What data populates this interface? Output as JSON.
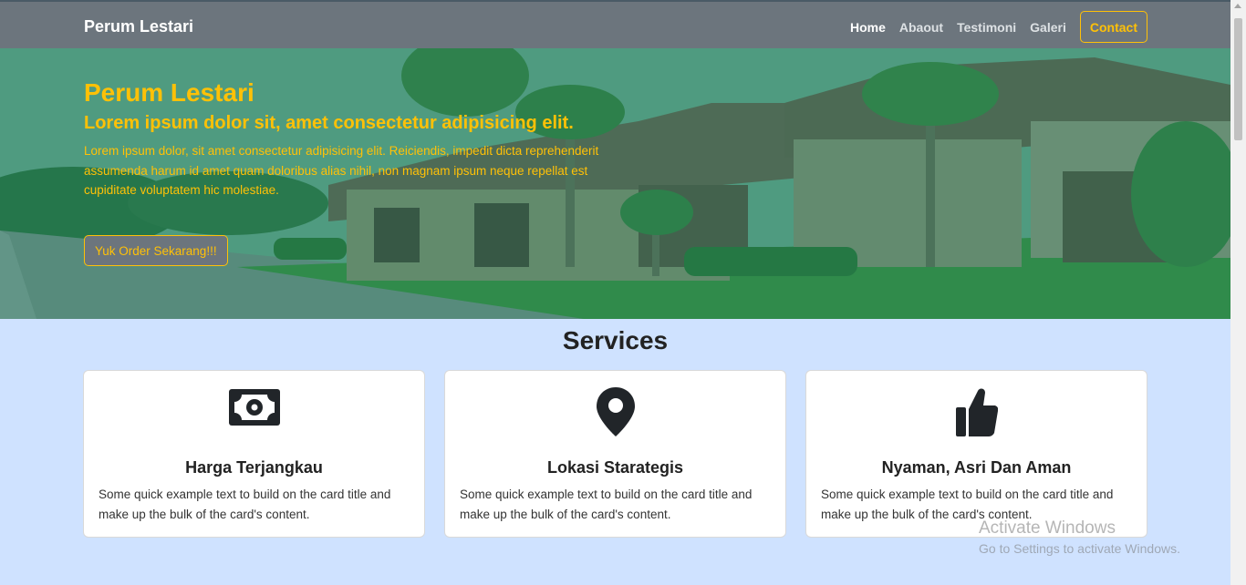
{
  "navbar": {
    "brand": "Perum Lestari",
    "links": [
      {
        "label": "Home",
        "active": true
      },
      {
        "label": "Abaout",
        "active": false
      },
      {
        "label": "Testimoni",
        "active": false
      },
      {
        "label": "Galeri",
        "active": false
      }
    ],
    "contact_label": "Contact"
  },
  "hero": {
    "title": "Perum Lestari",
    "subtitle": "Lorem ipsum dolor sit, amet consectetur adipisicing elit.",
    "text": "Lorem ipsum dolor, sit amet consectetur adipisicing elit. Reiciendis, impedit dicta reprehenderit assumenda harum id amet quam doloribus alias nihil, non magnam ipsum neque repellat est cupiditate voluptatem hic molestiae.",
    "button_label": "Yuk Order Sekarang!!!"
  },
  "services": {
    "title": "Services",
    "cards": [
      {
        "icon": "money-bill-icon",
        "title": "Harga Terjangkau",
        "text": "Some quick example text to build on the card title and make up the bulk of the card's content."
      },
      {
        "icon": "map-marker-icon",
        "title": "Lokasi Starategis",
        "text": "Some quick example text to build on the card title and make up the bulk of the card's content."
      },
      {
        "icon": "thumbs-up-icon",
        "title": "Nyaman, Asri Dan Aman",
        "text": "Some quick example text to build on the card title and make up the bulk of the card's content."
      }
    ]
  },
  "watermark": {
    "title": "Activate Windows",
    "subtitle": "Go to Settings to activate Windows."
  },
  "colors": {
    "navbar": "#6c757d",
    "accent": "#ffc107",
    "page_background": "#cfe2ff"
  }
}
